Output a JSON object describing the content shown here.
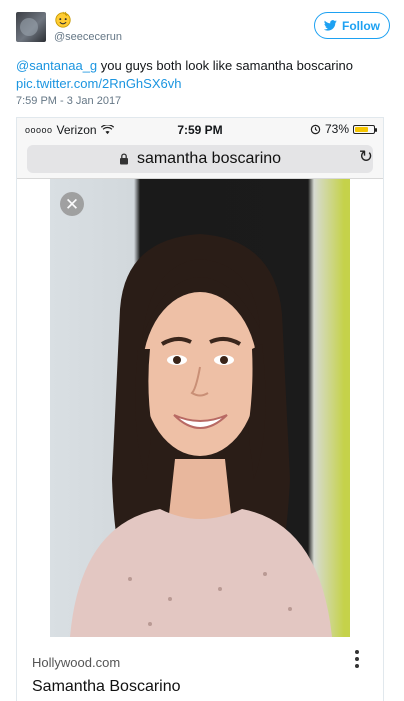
{
  "tweet": {
    "handle": "@seececerun",
    "follow_label": "Follow",
    "text_mention": "@santanaa_g",
    "text_body": " you guys both look like samantha boscarino",
    "text_link": "pic.twitter.com/2RnGhSX6vh",
    "timestamp": "7:59 PM - 3 Jan 2017"
  },
  "phone": {
    "carrier_dots": "ooooo",
    "carrier": "Verizon",
    "time": "7:59 PM",
    "battery": "73%",
    "battery_level": 0.73,
    "url_text": "samantha boscarino",
    "result_source": "Hollywood.com",
    "result_title": "Samantha Boscarino"
  },
  "colors": {
    "twitter_blue": "#1da1f2",
    "link_blue": "#1b95e0",
    "battery_yellow": "#f5c500"
  },
  "icons": [
    "avatar",
    "smiley-emoji-icon",
    "twitter-bird-icon",
    "wifi-icon",
    "alarm-icon",
    "battery-icon",
    "lock-icon",
    "reload-icon",
    "close-icon",
    "more-options-icon"
  ]
}
